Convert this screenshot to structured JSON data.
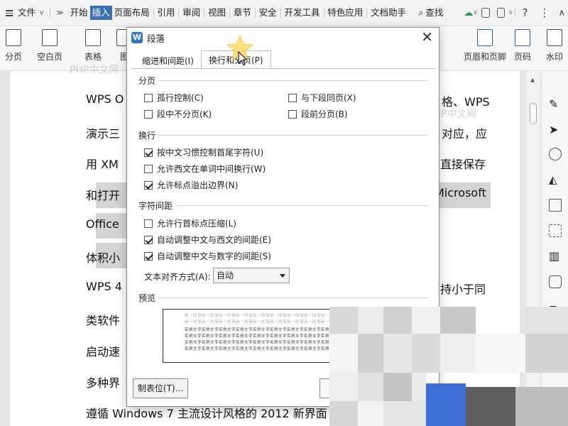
{
  "menubar": {
    "file": "文件",
    "items": [
      "开始",
      "插入",
      "页面布局",
      "引用",
      "审阅",
      "视图",
      "章节",
      "安全",
      "开发工具",
      "特色应用",
      "文档助手"
    ],
    "active_index": 1,
    "search": "查找"
  },
  "ribbon": {
    "page_break": "分页",
    "blank_page": "空白页",
    "table": "表格",
    "image_partial": "图",
    "header_footer": "页眉和页脚",
    "page_number": "页码",
    "watermark": "水印"
  },
  "document": {
    "lines": [
      "WPS O",
      "演示三",
      "用 XM",
      "和打开",
      "Office",
      "体积小",
      "WPS 4",
      "类软件",
      "启动速",
      "多种界",
      "遵循  Windows 7 主流设计风格的 2012 新界面"
    ],
    "right_fragments": [
      {
        "text": "格、WPS"
      },
      {
        "text": "对应，应"
      },
      {
        "text": "直接保存"
      },
      {
        "text": "Microsoft"
      },
      {
        "text": "持小于同"
      }
    ]
  },
  "watermark_text": "PHP中文网",
  "dialog": {
    "title": "段落",
    "tab_indent": "缩进和间距(I)",
    "tab_breaks": "换行和分页(P)",
    "group_pagination": "分页",
    "widow_control": {
      "label": "孤行控制(C)",
      "checked": false
    },
    "keep_with_next": {
      "label": "与下段同页(X)",
      "checked": false
    },
    "keep_lines": {
      "label": "段中不分页(K)",
      "checked": false
    },
    "page_break_before": {
      "label": "段前分页(B)",
      "checked": false
    },
    "group_line_break": "换行",
    "cjk_line_control": {
      "label": "按中文习惯控制首尾字符(U)",
      "checked": true
    },
    "word_wrap": {
      "label": "允许西文在单词中间换行(W)",
      "checked": false
    },
    "hanging_punct": {
      "label": "允许标点溢出边界(N)",
      "checked": true
    },
    "group_spacing": "字符间距",
    "compress_punct": {
      "label": "允许行首标点压缩(L)",
      "checked": false
    },
    "auto_space_en": {
      "label": "自动调整中文与西文的间距(E)",
      "checked": true
    },
    "auto_space_num": {
      "label": "自动调整中文与数字的间距(S)",
      "checked": true
    },
    "align_label": "文本对齐方式(A):",
    "align_value": "自动",
    "group_preview": "预览",
    "preview_prev": "前一段落前一段落前一段落前一段落前一段落前一段落前一段落前一段落前一段落前一段落前一段落前一段落",
    "preview_sample": "实例文字实例文字实例文字实例文字实例文字实例文字实例文字实例文字实例文字实例文字实例文字实例文字",
    "tabstops_button": "制表位(T)..."
  }
}
